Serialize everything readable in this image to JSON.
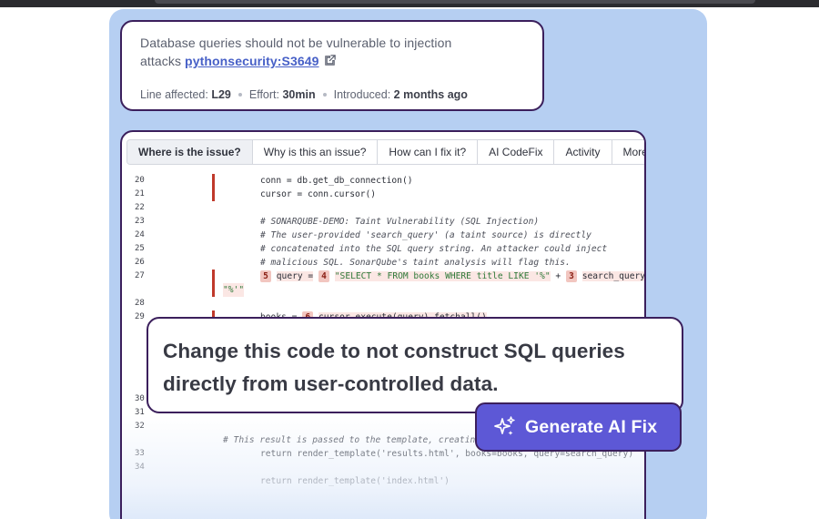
{
  "issue": {
    "title_line1": "Database queries should not be vulnerable to injection",
    "title_line2_prefix": "attacks ",
    "rule_key": "pythonsecurity:S3649",
    "line_label": "Line affected:",
    "line_value": "L29",
    "effort_label": "Effort:",
    "effort_value": "30min",
    "introduced_label": "Introduced:",
    "introduced_value": "2 months ago"
  },
  "tabs": [
    {
      "label": "Where is the issue?"
    },
    {
      "label": "Why is this an issue?"
    },
    {
      "label": "How can I fix it?"
    },
    {
      "label": "AI CodeFix"
    },
    {
      "label": "Activity"
    },
    {
      "label": "More info"
    }
  ],
  "code": {
    "l20": {
      "num": "20",
      "text": "conn = db.get_db_connection()"
    },
    "l21": {
      "num": "21",
      "text": "cursor = conn.cursor()"
    },
    "l22": {
      "num": "22"
    },
    "l23": {
      "num": "23",
      "text": "# SONARQUBE-DEMO: Taint Vulnerability (SQL Injection)"
    },
    "l24": {
      "num": "24",
      "text": "# The user-provided 'search_query' (a taint source) is directly"
    },
    "l25": {
      "num": "25",
      "text": "# concatenated into the SQL query string. An attacker could inject"
    },
    "l26": {
      "num": "26",
      "text": "# malicious SQL. SonarQube's taint analysis will flag this."
    },
    "l27": {
      "num": "27",
      "badge5": "5",
      "t1": "query =",
      "badge4": "4",
      "str": "\"SELECT * FROM books WHERE title LIKE '%\"",
      "plus1": " + ",
      "badge3": "3",
      "t2": "search_query +",
      "cont": "\"%'\""
    },
    "l28": {
      "num": "28"
    },
    "l29": {
      "num": "29",
      "t1": "books =",
      "badge6": "6",
      "t2": "cursor.execute(query).fetchall()"
    },
    "l30": {
      "num": "30"
    },
    "l31": {
      "num": "31"
    },
    "l32": {
      "num": "32"
    },
    "comment": "# This result is passed to the template, creating the",
    "l33": {
      "num": "33",
      "text": "return render_template('results.html', books=books, query=search_query)"
    },
    "l34": {
      "num": "34"
    },
    "l35": {
      "text": "return render_template('index.html')"
    }
  },
  "callout": {
    "line1": "Change this code to not construct SQL queries",
    "line2": "directly from user-controlled data."
  },
  "ai_fix": {
    "label": "Generate AI Fix"
  },
  "colors": {
    "panel_bg": "#b6cff2",
    "card_border": "#3b1f5c",
    "link": "#4760c7",
    "issue_gutter": "#c0392b",
    "ai_button": "#5d58d6"
  }
}
